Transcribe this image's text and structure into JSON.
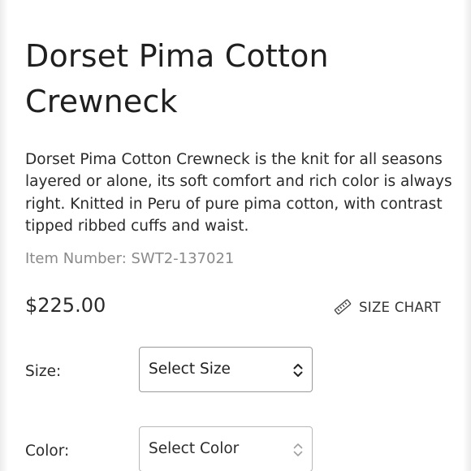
{
  "product": {
    "title": "Dorset Pima Cotton Crewneck",
    "description": "Dorset Pima Cotton Crewneck is the knit for all seasons layered or alone, its soft comfort and rich color is always right. Knitted in Peru of pure pima cotton, with contrast tipped ribbed cuffs and waist.",
    "item_number": "Item Number: SWT2-137021",
    "price": "$225.00"
  },
  "size_chart": {
    "label": "SIZE CHART",
    "icon": "ruler-icon"
  },
  "options": {
    "size": {
      "label": "Size:",
      "selected": "Select Size",
      "icon": "chevron-up-down-icon"
    },
    "color": {
      "label": "Color:",
      "selected": "Select Color",
      "icon": "chevron-up-down-icon"
    }
  },
  "colors": {
    "text": "#1f1f1f",
    "muted": "#8a8a8a",
    "border": "#9a9a9a",
    "background": "#ffffff"
  }
}
